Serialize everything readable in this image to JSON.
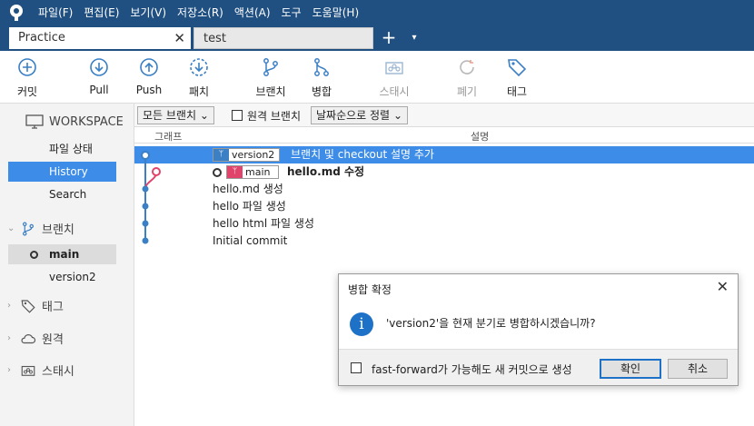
{
  "menu": [
    "파일(F)",
    "편집(E)",
    "보기(V)",
    "저장소(R)",
    "액션(A)",
    "도구",
    "도움말(H)"
  ],
  "tabs": {
    "active": "Practice",
    "inactive": "test",
    "close": "✕",
    "new": "+",
    "dropdown": "▾"
  },
  "toolbar": {
    "commit": "커밋",
    "pull": "Pull",
    "push": "Push",
    "fetch": "패치",
    "branch": "브랜치",
    "merge": "병합",
    "stash": "스태시",
    "discard": "폐기",
    "tag": "태그"
  },
  "sidebar": {
    "workspace": "WORKSPACE",
    "file_status": "파일 상태",
    "history": "History",
    "search": "Search",
    "branches": "브랜치",
    "branch_main": "main",
    "branch_version2": "version2",
    "tags": "태그",
    "remotes": "원격",
    "stashes": "스태시"
  },
  "filter": {
    "branches": "모든 브랜치",
    "remote_label": "원격 브랜치",
    "sort": "날짜순으로 정렬"
  },
  "columns": {
    "graph": "그래프",
    "description": "설명"
  },
  "commits": [
    {
      "badge": "version2",
      "message": "브랜치 및 checkout 설명 추가"
    },
    {
      "badge": "main",
      "message": "hello.md 수정"
    },
    {
      "badge": "",
      "message": "hello.md 생성"
    },
    {
      "badge": "",
      "message": "hello 파일 생성"
    },
    {
      "badge": "",
      "message": "hello html 파일 생성"
    },
    {
      "badge": "",
      "message": "Initial commit"
    }
  ],
  "dialog": {
    "title": "병합 확정",
    "close": "✕",
    "message": "'version2'을 현재 분기로 병합하시겠습니까?",
    "ff_label": "fast-forward가 가능해도 새 커밋으로 생성",
    "ok": "확인",
    "cancel": "취소"
  },
  "colors": {
    "chrome": "#205081",
    "selection": "#3c8ce8",
    "graph_blue": "#3b7fc4",
    "graph_pink": "#e0446b"
  }
}
